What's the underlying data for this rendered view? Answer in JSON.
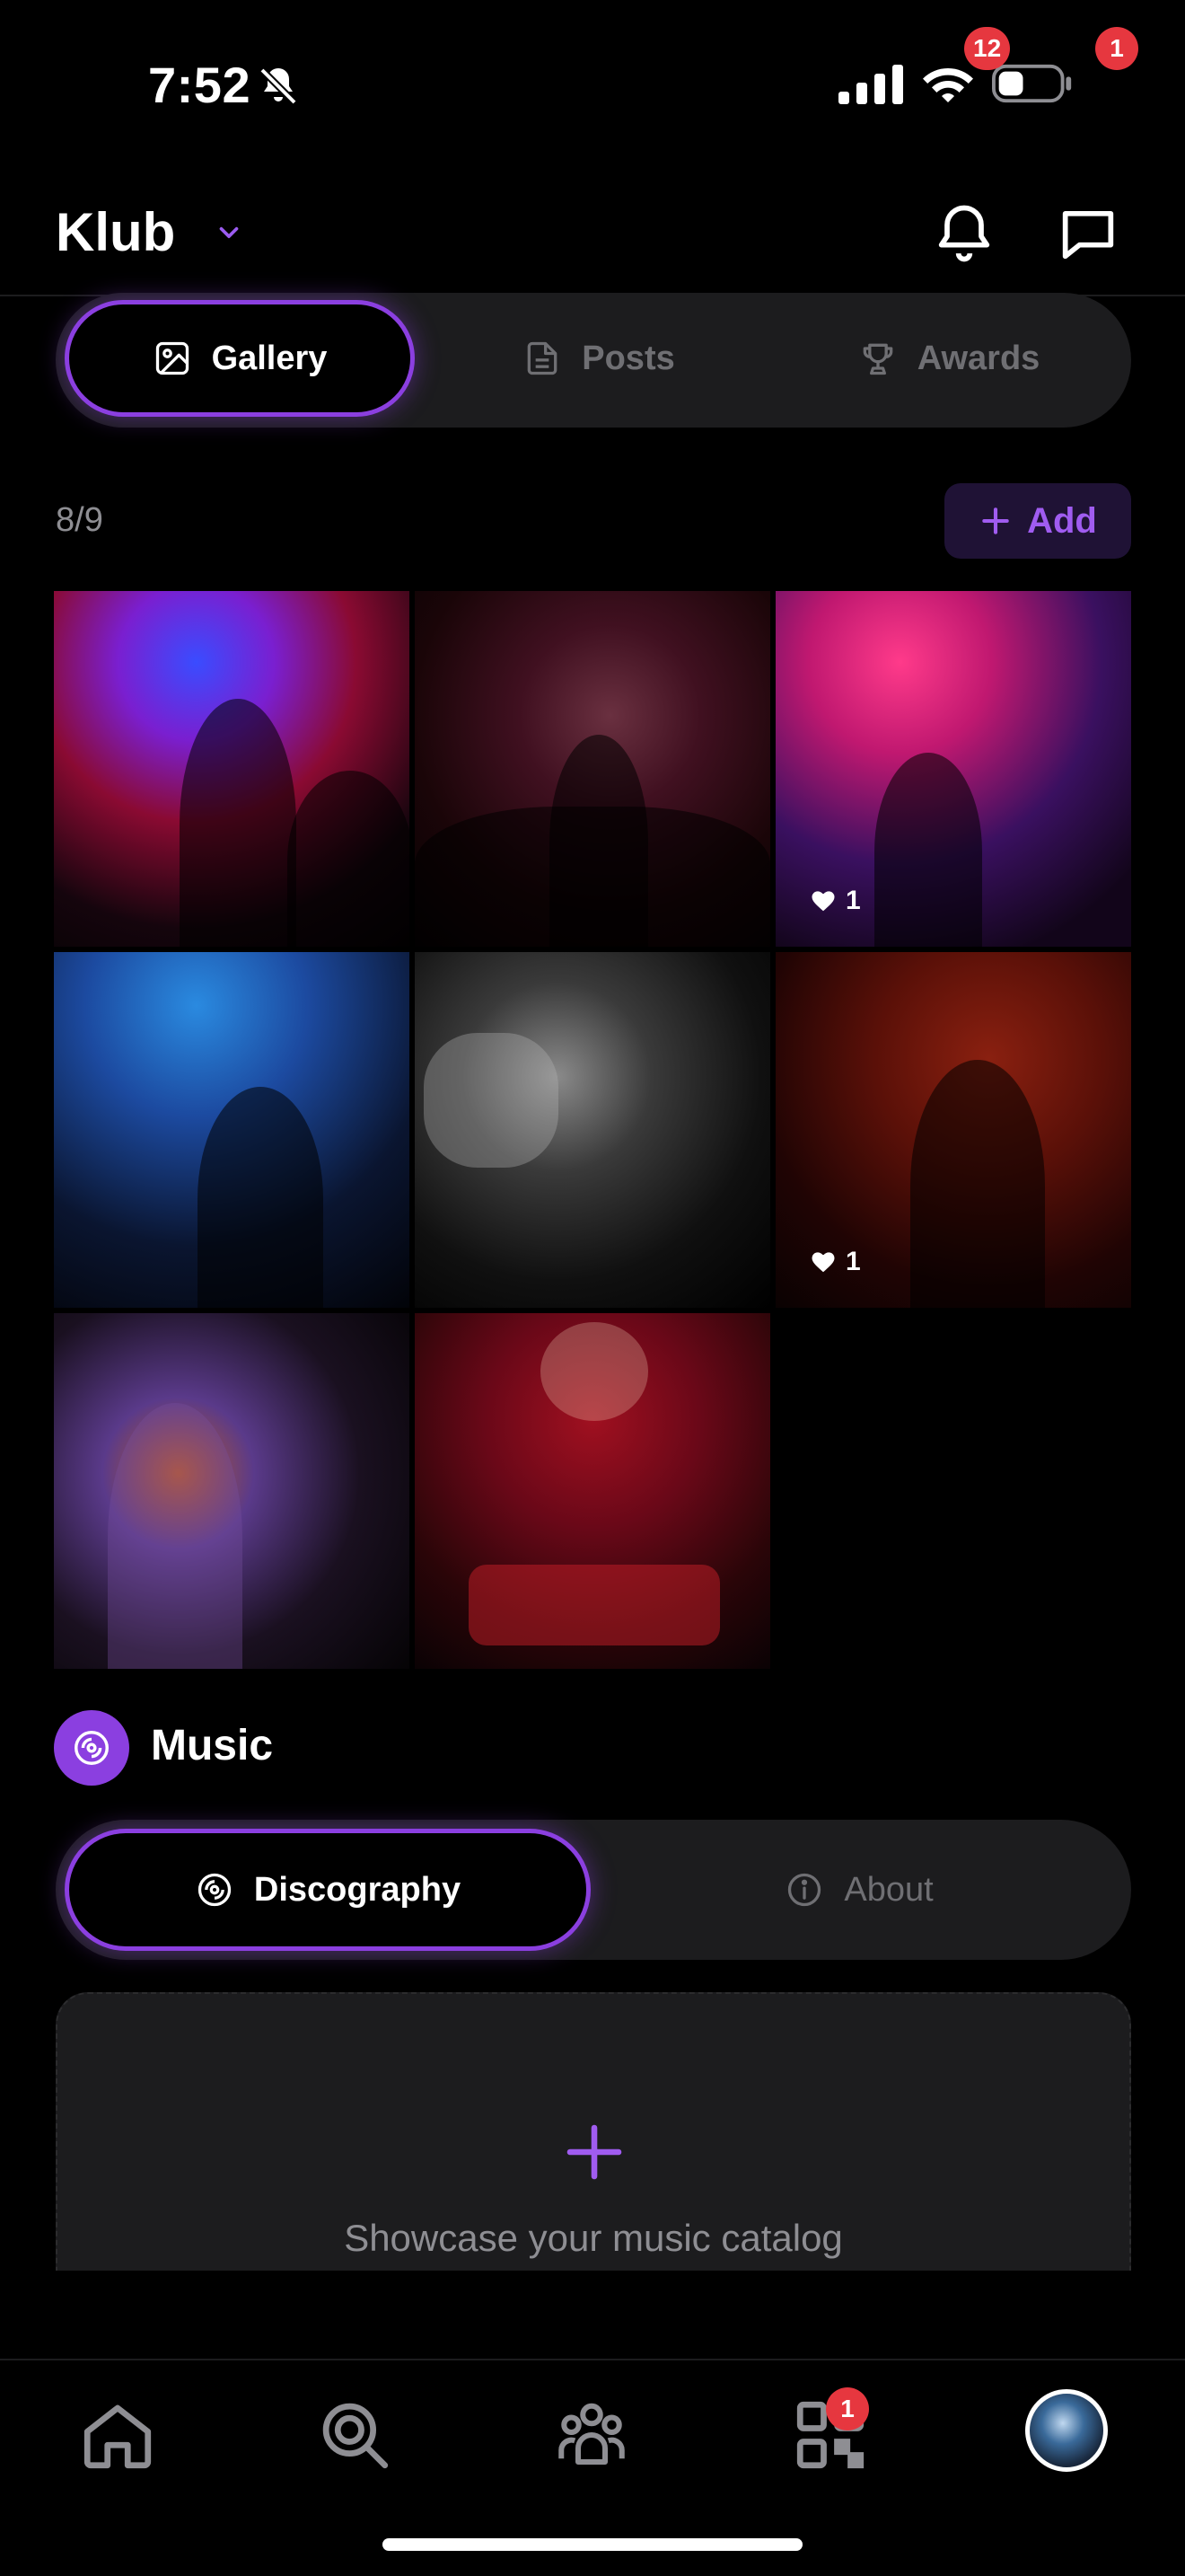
{
  "status_bar": {
    "time": "7:52",
    "icons": [
      "bell-muted-icon",
      "signal-icon",
      "wifi-icon",
      "battery-icon"
    ]
  },
  "header": {
    "brand": "Klub",
    "notifications_badge": "12",
    "messages_badge": "1"
  },
  "gallery_tabs": [
    {
      "label": "Gallery",
      "icon": "image-icon",
      "active": true
    },
    {
      "label": "Posts",
      "icon": "document-icon",
      "active": false
    },
    {
      "label": "Awards",
      "icon": "trophy-icon",
      "active": false
    }
  ],
  "gallery": {
    "count": "8/9",
    "add_label": "Add",
    "photos": [
      {
        "likes": ""
      },
      {
        "likes": ""
      },
      {
        "likes": "1"
      },
      {
        "likes": ""
      },
      {
        "likes": ""
      },
      {
        "likes": "1"
      },
      {
        "likes": ""
      },
      {
        "likes": ""
      }
    ]
  },
  "music": {
    "title": "Music",
    "tabs": [
      {
        "label": "Discography",
        "icon": "vinyl-icon",
        "active": true
      },
      {
        "label": "About",
        "icon": "info-icon",
        "active": false
      }
    ],
    "empty_text": "Showcase your music catalog"
  },
  "tab_bar": {
    "items": [
      "home-icon",
      "search-icon",
      "community-icon",
      "qr-icon",
      "profile-avatar"
    ],
    "qr_badge": "1"
  },
  "colors": {
    "accent": "#8b3fe0",
    "badge": "#e6373f",
    "background": "#000000",
    "surface": "#1c1c1e"
  }
}
